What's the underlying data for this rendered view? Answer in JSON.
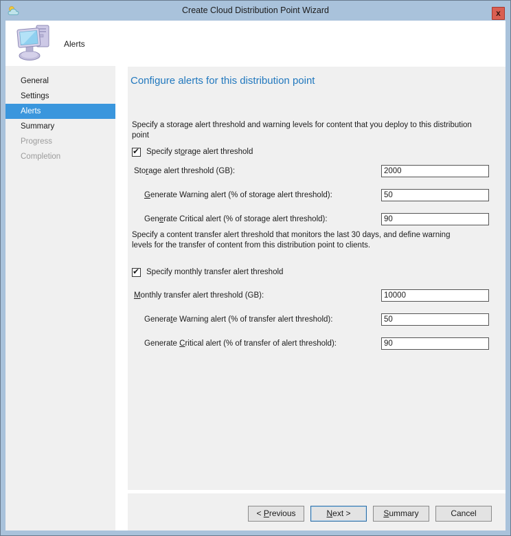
{
  "window": {
    "title": "Create Cloud Distribution Point Wizard",
    "close_glyph": "x"
  },
  "header": {
    "step_title": "Alerts"
  },
  "sidebar": {
    "items": [
      {
        "label": "General",
        "state": "normal"
      },
      {
        "label": "Settings",
        "state": "normal"
      },
      {
        "label": "Alerts",
        "state": "selected"
      },
      {
        "label": "Summary",
        "state": "normal"
      },
      {
        "label": "Progress",
        "state": "disabled"
      },
      {
        "label": "Completion",
        "state": "disabled"
      }
    ]
  },
  "main": {
    "heading": "Configure alerts for this distribution point",
    "section1": {
      "intro": "Specify a storage alert threshold and warning levels for content that you deploy to this distribution point",
      "checkbox": {
        "pre": "Specify st",
        "key": "o",
        "post": "rage alert threshold",
        "checked": true
      },
      "rows": [
        {
          "label": {
            "pre": "Sto",
            "key": "r",
            "post": "age alert threshold (GB):"
          },
          "value": "2000"
        },
        {
          "label": {
            "pre": "",
            "key": "G",
            "post": "enerate Warning alert (% of storage alert threshold):"
          },
          "value": "50"
        },
        {
          "label": {
            "pre": "Gen",
            "key": "e",
            "post": "rate Critical alert (% of storage alert threshold):"
          },
          "value": "90"
        }
      ]
    },
    "section2": {
      "intro": "Specify a content transfer alert threshold that monitors the last 30 days, and define warning levels for the transfer of content from this distribution point to clients.",
      "checkbox": {
        "pre": "Specify monthly transfer alert threshold",
        "key": "",
        "post": "",
        "checked": true
      },
      "rows": [
        {
          "label": {
            "pre": "",
            "key": "M",
            "post": "onthly transfer alert threshold (GB):"
          },
          "value": "10000"
        },
        {
          "label": {
            "pre": "Genera",
            "key": "t",
            "post": "e Warning alert (% of transfer alert threshold):"
          },
          "value": "50"
        },
        {
          "label": {
            "pre": "Generate ",
            "key": "C",
            "post": "ritical alert (% of transfer of alert threshold):"
          },
          "value": "90"
        }
      ]
    }
  },
  "footer": {
    "buttons": {
      "previous": {
        "pre": "< ",
        "key": "P",
        "post": "revious"
      },
      "next": {
        "pre": "",
        "key": "N",
        "post": "ext >"
      },
      "summary": {
        "pre": "",
        "key": "S",
        "post": "ummary"
      },
      "cancel": {
        "pre": "Cancel",
        "key": "",
        "post": ""
      }
    }
  },
  "colors": {
    "titlebar": "#a9c2db",
    "selection_blue": "#3a96dd",
    "heading_blue": "#2178be",
    "close_red": "#d95f52",
    "panel_gray": "#f0f0f0"
  }
}
